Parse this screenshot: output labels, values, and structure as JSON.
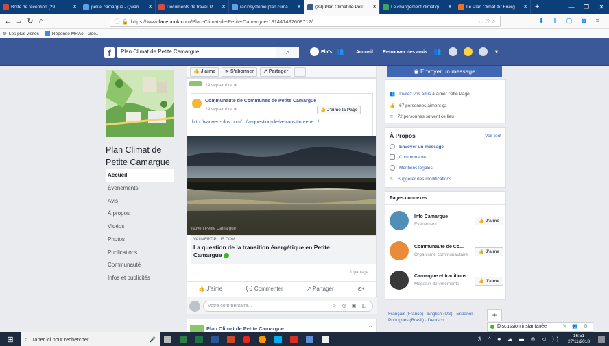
{
  "browser": {
    "tabs": [
      {
        "title": "Boîte de réception (29",
        "icon_color": "#d14836",
        "active": false
      },
      {
        "title": "petite camargue - Qwan",
        "icon_color": "#5ca1e6",
        "active": false
      },
      {
        "title": "Documents de travail P",
        "icon_color": "#e0483b",
        "active": false
      },
      {
        "title": "radiosystème plan clima",
        "icon_color": "#5ca1e6",
        "active": false
      },
      {
        "title": "(89) Plan Climat de Petit",
        "icon_color": "#3b5998",
        "active": true
      },
      {
        "title": "Le changement climatiqu",
        "icon_color": "#3aa55c",
        "active": false
      },
      {
        "title": "Le Plan Climat Air Energ",
        "icon_color": "#f36f21",
        "active": false
      }
    ],
    "url_prefix": "https://www.",
    "url_domain": "facebook.com",
    "url_path": "/Plan-Climat-de-Petite-Camargue-181441482608712/",
    "bookmarks": [
      "Les plus visités",
      "Réponse MRAe - Goo..."
    ]
  },
  "fb_header": {
    "search_value": "Plan Climat de Petite Camargue",
    "user": "Elaïs",
    "home": "Accueil",
    "find_friends": "Retrouver des amis"
  },
  "left": {
    "page_name": "Plan Climat de Petite Camargue",
    "nav": [
      "Accueil",
      "Événements",
      "Avis",
      "À propos",
      "Vidéos",
      "Photos",
      "Publications",
      "Communauté",
      "Infos et publicités"
    ]
  },
  "center": {
    "actions": [
      "J'aime",
      "S'abonner",
      "Partager",
      "···"
    ],
    "post_date": "24 septembre",
    "shared_author": "Communauté de Communes de Petite Camargue",
    "shared_date": "24 septembre",
    "like_page": "J'aime la Page",
    "link_url": "http://vauvert-plus.com/.../la-question-de-la-transition-ene.../",
    "image_caption": "Vauvert Petite Camargue",
    "link_domain": "VAUVERT-PLUS.COM",
    "link_title": "La question de la transition énergétique en Petite Camargue",
    "shares": "1 partage",
    "reactions": [
      "J'aime",
      "Commenter",
      "Partager"
    ],
    "comment_placeholder": "Votre commentaire...",
    "next_post_author": "Plan Climat de Petite Camargue"
  },
  "right": {
    "send_message": "Envoyer un message",
    "invite_link": "Invitez vos amis",
    "invite_rest": "à aimer cette Page",
    "likes": "67 personnes aiment ça",
    "follows": "72 personnes suivent ce lieu",
    "about_title": "À Propos",
    "see_all": "Voir tout",
    "about_items": [
      "Envoyer un message",
      "Communauté",
      "Mentions légales",
      "Suggérer des modifications"
    ],
    "related_title": "Pages connexes",
    "related": [
      {
        "name": "Info Camargue",
        "category": "Événement",
        "like": "J'aime"
      },
      {
        "name": "Communauté de Co...",
        "category": "Organisme communautaire",
        "like": "J'aime"
      },
      {
        "name": "Camargue et traditions",
        "category": "Magasin de vêtements",
        "like": "J'aime"
      }
    ],
    "languages_1": "Français (France) · English (US) · Español",
    "languages_2": "Português (Brasil) · Deutsch",
    "chat": "Discussion instantanée"
  },
  "taskbar": {
    "search_placeholder": "Taper ici pour rechercher",
    "time": "16:51",
    "date": "27/11/2018"
  }
}
